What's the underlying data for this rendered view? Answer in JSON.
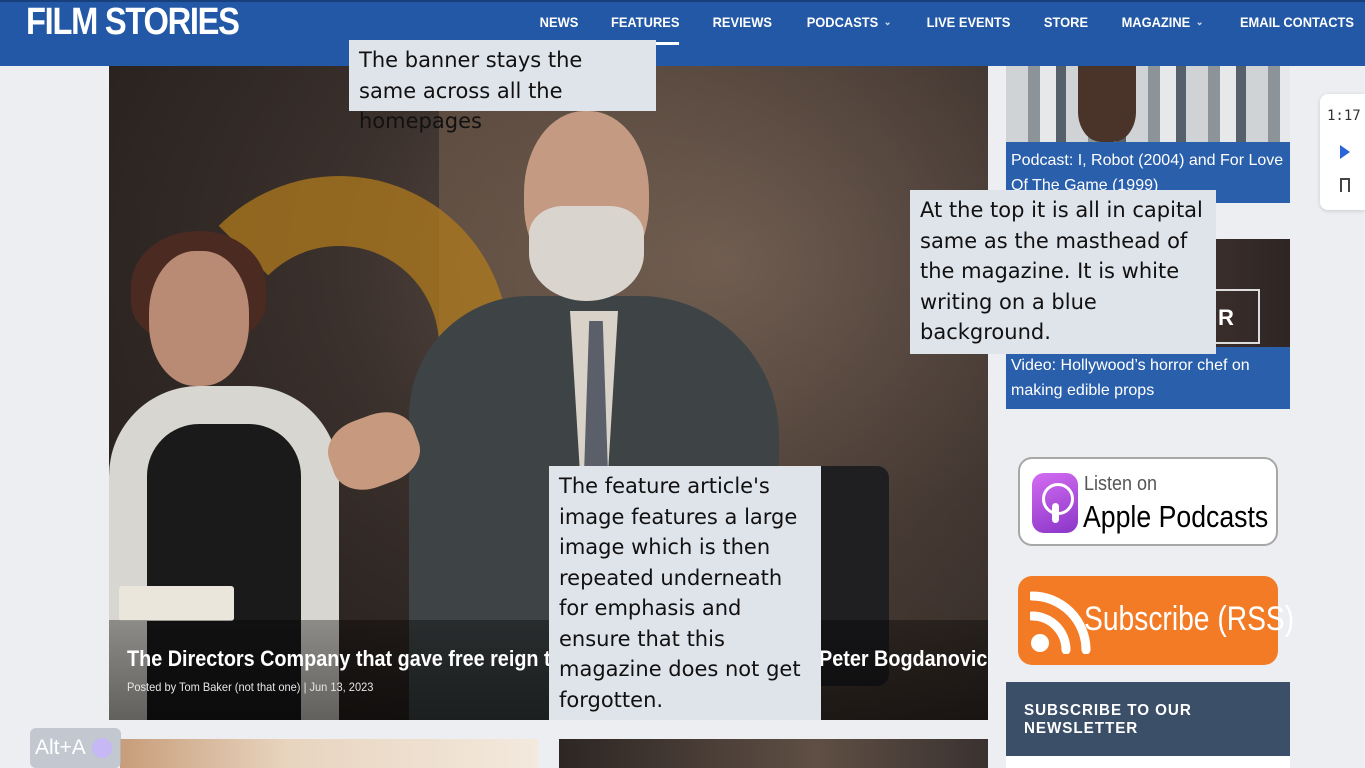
{
  "header": {
    "logo": "FILM STORIES",
    "nav": [
      {
        "label": "NEWS",
        "active": false,
        "dropdown": false
      },
      {
        "label": "FEATURES",
        "active": true,
        "dropdown": false
      },
      {
        "label": "REVIEWS",
        "active": false,
        "dropdown": false
      },
      {
        "label": "PODCASTS",
        "active": false,
        "dropdown": true
      },
      {
        "label": "LIVE EVENTS",
        "active": false,
        "dropdown": false
      },
      {
        "label": "STORE",
        "active": false,
        "dropdown": false
      },
      {
        "label": "MAGAZINE",
        "active": false,
        "dropdown": true
      },
      {
        "label": "EMAIL CONTACTS",
        "active": false,
        "dropdown": false
      }
    ],
    "colors": {
      "bar": "#2258a6",
      "text": "#ffffff"
    }
  },
  "hero": {
    "title": "The Directors Company that gave free reign to Francis Ford Coppola and Peter Bogdanovich",
    "meta_prefix": "Posted by",
    "author": "Tom Baker (not that one)",
    "separator": "|",
    "date": "Jun 13, 2023"
  },
  "sidebar": {
    "cards": [
      {
        "caption": "Podcast: I, Robot (2004) and For Love Of The Game (1999)"
      },
      {
        "caption": "Video: Hollywood’s horror chef on making edible props",
        "frame_text": "R"
      }
    ],
    "apple_badge": {
      "small": "Listen on",
      "big": "Apple Podcasts"
    },
    "rss_badge": {
      "label": "Subscribe (RSS)",
      "color": "#f47b26"
    },
    "newsletter": {
      "title": "SUBSCRIBE TO OUR NEWSLETTER"
    }
  },
  "audio_widget": {
    "time": "1:17",
    "icons": [
      "play-icon",
      "bookmark-icon"
    ]
  },
  "shortcut_pill": {
    "label": "Alt+A"
  },
  "annotations": [
    "The banner stays the same across all the homepages",
    "At the top it is all in capital same as the masthead of the magazine. It is white writing on a blue background.",
    "The feature article's image features a large image which is then repeated underneath for emphasis and ensure that this magazine does not get forgotten."
  ]
}
